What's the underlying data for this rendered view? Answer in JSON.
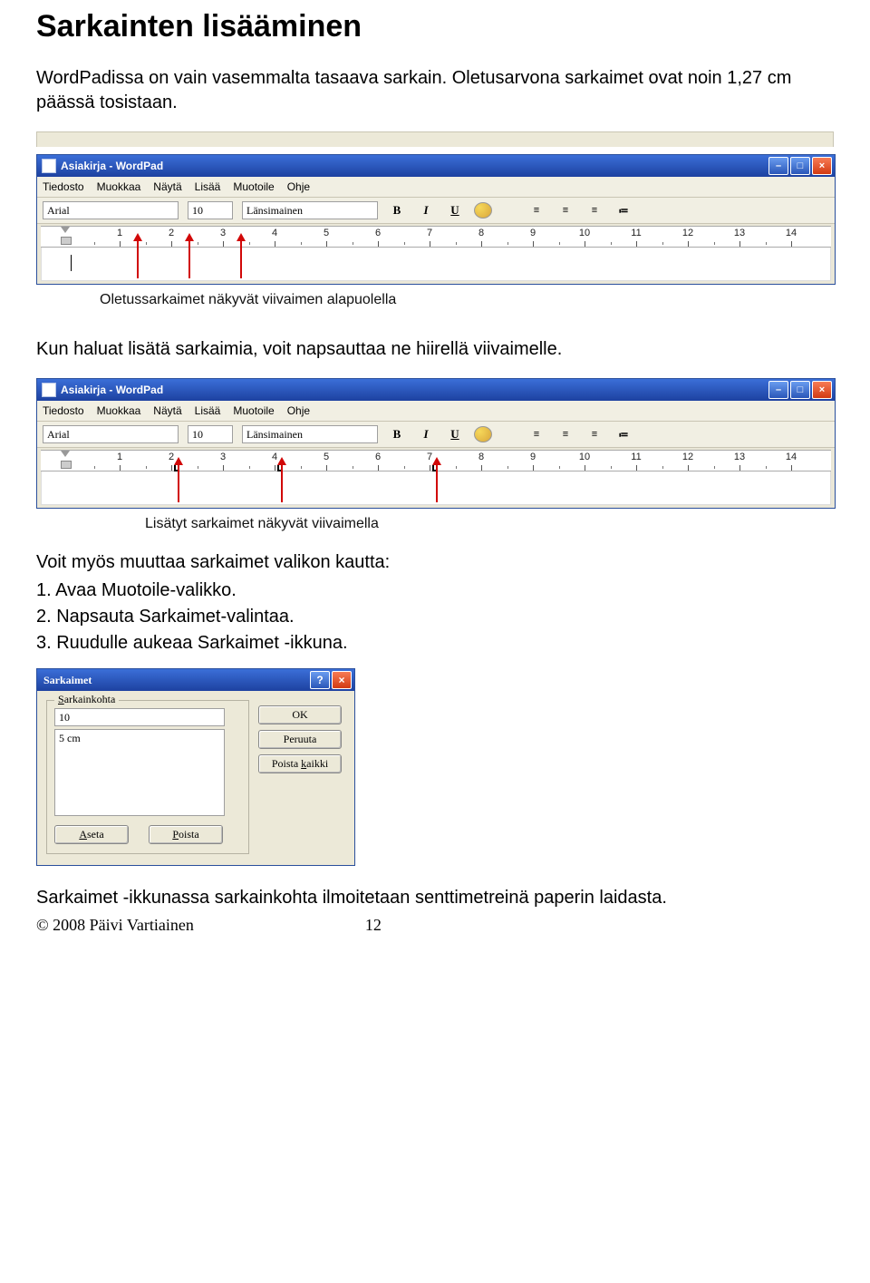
{
  "heading": "Sarkainten lisääminen",
  "intro": "WordPadissa on vain vasemmalta tasaava sarkain. Oletusarvona sarkaimet ovat noin 1,27 cm päässä tosistaan.",
  "caption1": "Oletussarkaimet näkyvät viivaimen alapuolella",
  "mid_text": "Kun haluat lisätä sarkaimia, voit napsauttaa ne hiirellä viivaimelle.",
  "caption2": "Lisätyt sarkaimet näkyvät viivaimella",
  "steps_intro": "Voit myös muuttaa sarkaimet valikon kautta:",
  "step1": "1. Avaa Muotoile-valikko.",
  "step2": "2. Napsauta Sarkaimet-valintaa.",
  "step3": "3. Ruudulle aukeaa Sarkaimet -ikkuna.",
  "closing": "Sarkaimet -ikkunassa sarkainkohta ilmoitetaan senttimetreinä paperin laidasta.",
  "footer_left": "© 2008 Päivi Vartiainen",
  "footer_right": "12",
  "wordpad": {
    "title": "Asiakirja - WordPad",
    "menus": [
      "Tiedosto",
      "Muokkaa",
      "Näytä",
      "Lisää",
      "Muotoile",
      "Ohje"
    ],
    "font": "Arial",
    "size": "10",
    "script": "Länsimainen",
    "bold": "B",
    "italic": "I",
    "underline": "U",
    "ruler_numbers": [
      "1",
      "2",
      "3",
      "4",
      "5",
      "6",
      "7",
      "8",
      "9",
      "10",
      "11",
      "12",
      "13",
      "14"
    ]
  },
  "dialog": {
    "title": "Sarkaimet",
    "group_label": "Sarkainkohta",
    "input_value": "10",
    "list_item": "5 cm",
    "btn_set": "Aseta",
    "btn_remove": "Poista",
    "btn_ok": "OK",
    "btn_cancel": "Peruuta",
    "btn_clear": "Poista kaikki",
    "help": "?",
    "close": "×"
  },
  "win_close": "×",
  "win_min": "–",
  "win_max": "□"
}
